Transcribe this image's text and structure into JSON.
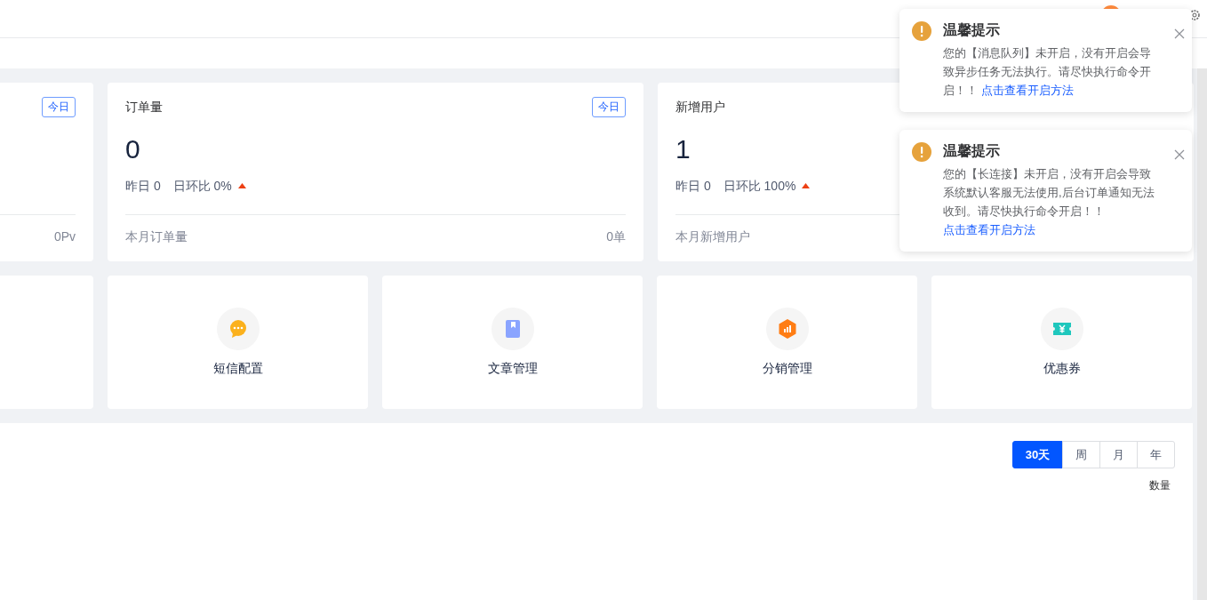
{
  "stat_cards": [
    {
      "badge": "今日",
      "footer_value": "0Pv"
    },
    {
      "title": "订单量",
      "badge": "今日",
      "value": "0",
      "yesterday": "昨日 0",
      "ratio": "日环比 0%",
      "rising": true,
      "footer_label": "本月订单量",
      "footer_value": "0单"
    },
    {
      "title": "新增用户",
      "value": "1",
      "yesterday": "昨日 0",
      "ratio": "日环比 100%",
      "rising": true,
      "footer_label": "本月新增用户"
    }
  ],
  "shortcuts": [
    {
      "kind": "none"
    },
    {
      "label": "短信配置",
      "kind": "message"
    },
    {
      "label": "文章管理",
      "kind": "bookmark"
    },
    {
      "label": "分销管理",
      "kind": "chart"
    },
    {
      "label": "优惠券",
      "kind": "coupon"
    }
  ],
  "chart_panel": {
    "periods": [
      {
        "label": "30天",
        "selected": true
      },
      {
        "label": "周",
        "selected": false
      },
      {
        "label": "月",
        "selected": false
      },
      {
        "label": "年",
        "selected": false
      }
    ],
    "axis_label": "数量"
  },
  "notifications": [
    {
      "title": "温馨提示",
      "text": "您的【消息队列】未开启，没有开启会导致异步任务无法执行。请尽快执行命令开启！！",
      "link": "点击查看开启方法"
    },
    {
      "title": "温馨提示",
      "text": "您的【长连接】未开启，没有开启会导致系统默认客服无法使用,后台订单通知无法收到。请尽快执行命令开启！！",
      "link": "点击查看开启方法"
    }
  ]
}
